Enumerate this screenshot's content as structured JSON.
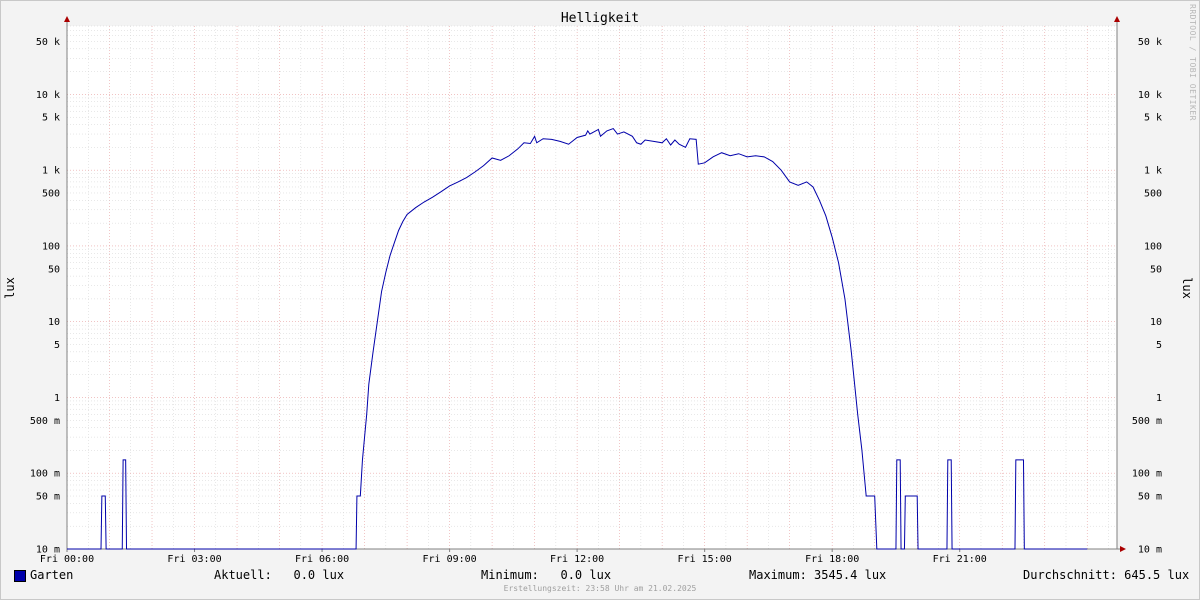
{
  "credit": "RRDTOOL / TOBI OETIKER",
  "timestamp": "Erstellungszeit: 23:58 Uhr am 21.02.2025",
  "legend": {
    "series_name": "Garten",
    "current": "Aktuell:   0.0 lux",
    "minimum": "Minimum:   0.0 lux",
    "maximum": "Maximum: 3545.4 lux",
    "average": "Durchschnitt: 645.5 lux"
  },
  "colors": {
    "series": "#0000aa",
    "grid_major": "#e8a0a0",
    "grid_minor": "#d0d0d0",
    "axis": "#808080",
    "arrow": "#aa0000"
  },
  "chart_data": {
    "type": "line",
    "title": "Helligkeit",
    "ylabel": "lux",
    "y_scale": "log",
    "ylim": [
      0.01,
      80000
    ],
    "xlim": [
      0,
      24.7
    ],
    "x_unit": "hours since Fri 00:00",
    "x_ticks": [
      {
        "label": "Fri 00:00",
        "value": 0
      },
      {
        "label": "Fri 03:00",
        "value": 3
      },
      {
        "label": "Fri 06:00",
        "value": 6
      },
      {
        "label": "Fri 09:00",
        "value": 9
      },
      {
        "label": "Fri 12:00",
        "value": 12
      },
      {
        "label": "Fri 15:00",
        "value": 15
      },
      {
        "label": "Fri 18:00",
        "value": 18
      },
      {
        "label": "Fri 21:00",
        "value": 21
      }
    ],
    "y_ticks": [
      {
        "label": "10 m",
        "value": 0.01
      },
      {
        "label": "50 m",
        "value": 0.05
      },
      {
        "label": "100 m",
        "value": 0.1
      },
      {
        "label": "500 m",
        "value": 0.5
      },
      {
        "label": "1",
        "value": 1
      },
      {
        "label": "5",
        "value": 5
      },
      {
        "label": "10",
        "value": 10
      },
      {
        "label": "50",
        "value": 50
      },
      {
        "label": "100",
        "value": 100
      },
      {
        "label": "500",
        "value": 500
      },
      {
        "label": "1 k",
        "value": 1000
      },
      {
        "label": "5 k",
        "value": 5000
      },
      {
        "label": "10 k",
        "value": 10000
      },
      {
        "label": "50 k",
        "value": 50000
      }
    ],
    "series": [
      {
        "name": "Garten",
        "points": [
          [
            0,
            0.01
          ],
          [
            0.8,
            0.01
          ],
          [
            0.82,
            0.05
          ],
          [
            0.9,
            0.05
          ],
          [
            0.92,
            0.01
          ],
          [
            1.3,
            0.01
          ],
          [
            1.32,
            0.15
          ],
          [
            1.38,
            0.15
          ],
          [
            1.4,
            0.01
          ],
          [
            6.8,
            0.01
          ],
          [
            6.82,
            0.05
          ],
          [
            6.9,
            0.05
          ],
          [
            6.95,
            0.15
          ],
          [
            7.0,
            0.3
          ],
          [
            7.05,
            0.6
          ],
          [
            7.1,
            1.5
          ],
          [
            7.2,
            4
          ],
          [
            7.3,
            10
          ],
          [
            7.4,
            25
          ],
          [
            7.5,
            45
          ],
          [
            7.6,
            75
          ],
          [
            7.7,
            110
          ],
          [
            7.8,
            160
          ],
          [
            7.9,
            210
          ],
          [
            8.0,
            260
          ],
          [
            8.2,
            320
          ],
          [
            8.4,
            380
          ],
          [
            8.6,
            440
          ],
          [
            8.8,
            520
          ],
          [
            9.0,
            620
          ],
          [
            9.2,
            700
          ],
          [
            9.4,
            800
          ],
          [
            9.6,
            950
          ],
          [
            9.8,
            1150
          ],
          [
            10.0,
            1450
          ],
          [
            10.2,
            1350
          ],
          [
            10.4,
            1550
          ],
          [
            10.6,
            1900
          ],
          [
            10.75,
            2300
          ],
          [
            10.9,
            2250
          ],
          [
            11.0,
            2800
          ],
          [
            11.05,
            2300
          ],
          [
            11.2,
            2600
          ],
          [
            11.4,
            2550
          ],
          [
            11.6,
            2400
          ],
          [
            11.8,
            2200
          ],
          [
            12.0,
            2700
          ],
          [
            12.2,
            2900
          ],
          [
            12.25,
            3300
          ],
          [
            12.3,
            3000
          ],
          [
            12.5,
            3450
          ],
          [
            12.55,
            2800
          ],
          [
            12.7,
            3300
          ],
          [
            12.85,
            3545
          ],
          [
            12.95,
            3000
          ],
          [
            13.1,
            3200
          ],
          [
            13.3,
            2800
          ],
          [
            13.4,
            2300
          ],
          [
            13.5,
            2200
          ],
          [
            13.6,
            2500
          ],
          [
            13.8,
            2400
          ],
          [
            14.0,
            2300
          ],
          [
            14.1,
            2600
          ],
          [
            14.2,
            2150
          ],
          [
            14.3,
            2500
          ],
          [
            14.4,
            2200
          ],
          [
            14.55,
            2000
          ],
          [
            14.65,
            2600
          ],
          [
            14.8,
            2550
          ],
          [
            14.85,
            1200
          ],
          [
            15.0,
            1250
          ],
          [
            15.2,
            1500
          ],
          [
            15.4,
            1700
          ],
          [
            15.6,
            1550
          ],
          [
            15.8,
            1650
          ],
          [
            16.0,
            1500
          ],
          [
            16.2,
            1550
          ],
          [
            16.4,
            1500
          ],
          [
            16.6,
            1300
          ],
          [
            16.8,
            1000
          ],
          [
            17.0,
            700
          ],
          [
            17.2,
            630
          ],
          [
            17.4,
            700
          ],
          [
            17.55,
            600
          ],
          [
            17.7,
            400
          ],
          [
            17.85,
            250
          ],
          [
            18.0,
            130
          ],
          [
            18.15,
            60
          ],
          [
            18.3,
            20
          ],
          [
            18.45,
            4
          ],
          [
            18.6,
            0.6
          ],
          [
            18.7,
            0.2
          ],
          [
            18.75,
            0.1
          ],
          [
            18.8,
            0.05
          ],
          [
            19.0,
            0.05
          ],
          [
            19.05,
            0.01
          ],
          [
            19.5,
            0.01
          ],
          [
            19.52,
            0.15
          ],
          [
            19.6,
            0.15
          ],
          [
            19.62,
            0.01
          ],
          [
            19.7,
            0.01
          ],
          [
            19.72,
            0.05
          ],
          [
            20.0,
            0.05
          ],
          [
            20.02,
            0.01
          ],
          [
            20.7,
            0.01
          ],
          [
            20.72,
            0.15
          ],
          [
            20.8,
            0.15
          ],
          [
            20.82,
            0.01
          ],
          [
            22.3,
            0.01
          ],
          [
            22.32,
            0.15
          ],
          [
            22.5,
            0.15
          ],
          [
            22.52,
            0.01
          ],
          [
            24.0,
            0.01
          ]
        ]
      }
    ]
  }
}
